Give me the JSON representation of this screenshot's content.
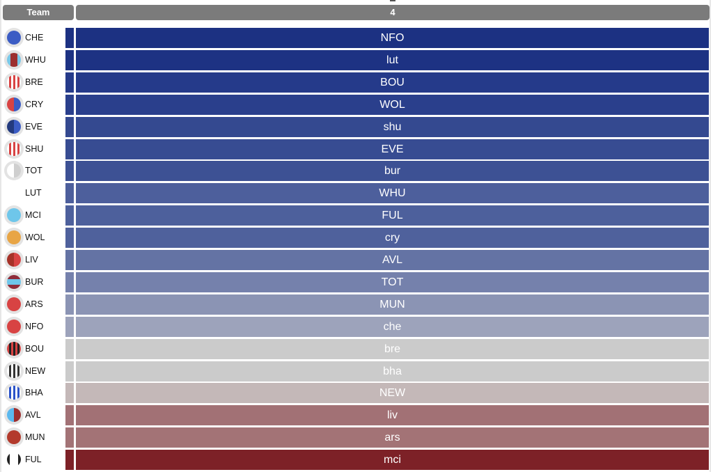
{
  "header": {
    "team_label": "Team",
    "column_label": "4"
  },
  "rows": [
    {
      "team": "CHE",
      "crest": "solid",
      "c1": "#3b5cc4",
      "c2": "#3b5cc4",
      "cell": "NFO",
      "color": "#1c3182"
    },
    {
      "team": "WHU",
      "crest": "center-stripe",
      "c1": "#7ac8e8",
      "c2": "#9c2f2f",
      "cell": "lut",
      "color": "#1d3283"
    },
    {
      "team": "BRE",
      "crest": "vstripes",
      "c1": "#ffffff",
      "c2": "#d84343",
      "cell": "BOU",
      "color": "#253a8a"
    },
    {
      "team": "CRY",
      "crest": "halves",
      "c1": "#d84343",
      "c2": "#3b5cc4",
      "cell": "WOL",
      "color": "#2a3f8c"
    },
    {
      "team": "EVE",
      "crest": "halves",
      "c1": "#233a7e",
      "c2": "#3b5cc4",
      "cell": "shu",
      "color": "#344990"
    },
    {
      "team": "SHU",
      "crest": "vstripes",
      "c1": "#ffffff",
      "c2": "#d84343",
      "cell": "EVE",
      "color": "#374c92"
    },
    {
      "team": "TOT",
      "crest": "halves",
      "c1": "#ffffff",
      "c2": "#cfcfcf",
      "cell": "bur",
      "color": "#3d5194"
    },
    {
      "team": "LUT",
      "crest": "none",
      "c1": "",
      "c2": "",
      "cell": "WHU",
      "color": "#4d5f9c"
    },
    {
      "team": "MCI",
      "crest": "solid",
      "c1": "#6ec6ea",
      "c2": "#6ec6ea",
      "cell": "FUL",
      "color": "#4d609c"
    },
    {
      "team": "WOL",
      "crest": "solid",
      "c1": "#e8a545",
      "c2": "#e8a545",
      "cell": "cry",
      "color": "#4f619c"
    },
    {
      "team": "LIV",
      "crest": "halves",
      "c1": "#a63228",
      "c2": "#d84343",
      "cell": "AVL",
      "color": "#6473a4"
    },
    {
      "team": "BUR",
      "crest": "hband",
      "c1": "#8f2c3a",
      "c2": "#6ec6ea",
      "cell": "TOT",
      "color": "#7581ac"
    },
    {
      "team": "ARS",
      "crest": "solid",
      "c1": "#d84343",
      "c2": "#d84343",
      "cell": "MUN",
      "color": "#8b94b4"
    },
    {
      "team": "NFO",
      "crest": "solid",
      "c1": "#d84343",
      "c2": "#d84343",
      "cell": "che",
      "color": "#9da3bb"
    },
    {
      "team": "BOU",
      "crest": "vstripes",
      "c1": "#d84343",
      "c2": "#222222",
      "cell": "bre",
      "color": "#cbcbcb"
    },
    {
      "team": "NEW",
      "crest": "vstripes",
      "c1": "#ffffff",
      "c2": "#333333",
      "cell": "bha",
      "color": "#cbcbcb"
    },
    {
      "team": "BHA",
      "crest": "vstripes",
      "c1": "#ffffff",
      "c2": "#2a52c8",
      "cell": "NEW",
      "color": "#c4b8b8"
    },
    {
      "team": "AVL",
      "crest": "halves",
      "c1": "#5bb8ee",
      "c2": "#9c2f2f",
      "cell": "liv",
      "color": "#a27175"
    },
    {
      "team": "MUN",
      "crest": "solid",
      "c1": "#b33a2c",
      "c2": "#b33a2c",
      "cell": "ars",
      "color": "#a37376"
    },
    {
      "team": "FUL",
      "crest": "ful",
      "c1": "#ffffff",
      "c2": "#222222",
      "cell": "mci",
      "color": "#7d2127"
    }
  ]
}
